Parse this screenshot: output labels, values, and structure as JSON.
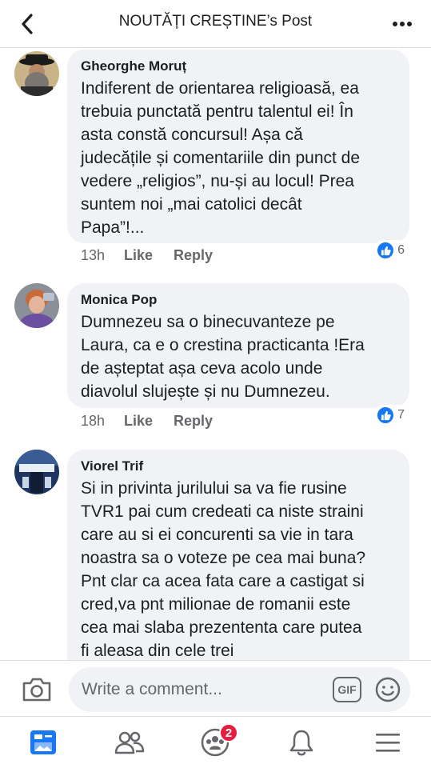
{
  "header": {
    "title": "NOUTĂȚI CREȘTINE’s Post",
    "back_icon": "chevron-left-icon",
    "more_icon": "more-horizontal-icon"
  },
  "comments": [
    {
      "author": "Gheorghe Moruț",
      "text": "Indiferent de orientarea religioasă, ea\ntrebuia punctată pentru talentul ei! În\nasta  constă concursul! Așa că\njudecățile și comentariile din punct de\nvedere „religios”, nu-și au locul! Prea\nsuntem noi „mai catolici decât\nPapa”!...",
      "time": "13h",
      "like_label": "Like",
      "reply_label": "Reply",
      "reaction_count": "6"
    },
    {
      "author": "Monica Pop",
      "text": "Dumnezeu sa o binecuvanteze pe\nLaura, ca e o crestina practicanta !Era\nde așteptat așa ceva acolo unde\ndiavolul slujește și nu Dumnezeu.",
      "time": "18h",
      "like_label": "Like",
      "reply_label": "Reply",
      "reaction_count": "7"
    },
    {
      "author": "Viorel Trif",
      "text": "Si in privinta jurilului sa va fie rusine\nTVR1 pai cum credeati ca niste straini\ncare au si ei concurenti sa vie in tara\nnoastra sa o voteze pe cea mai buna?\nPnt clar ca acea fata care a castigat si\ncred,va pnt milionae de romanii este\ncea mai slaba prezententa care putea\nfi aleasa din cele trei"
    }
  ],
  "composer": {
    "placeholder": "Write a comment...",
    "gif_label": "GIF",
    "camera_icon": "camera-icon",
    "emoji_icon": "emoji-icon"
  },
  "nav": {
    "items": [
      "news-feed-icon",
      "friends-icon",
      "groups-icon",
      "notifications-icon",
      "menu-icon"
    ],
    "groups_badge": "2"
  },
  "colors": {
    "accent": "#1877f2",
    "bubble": "#f0f2f5",
    "secondary_text": "#65676b",
    "badge": "#e41e3f"
  }
}
